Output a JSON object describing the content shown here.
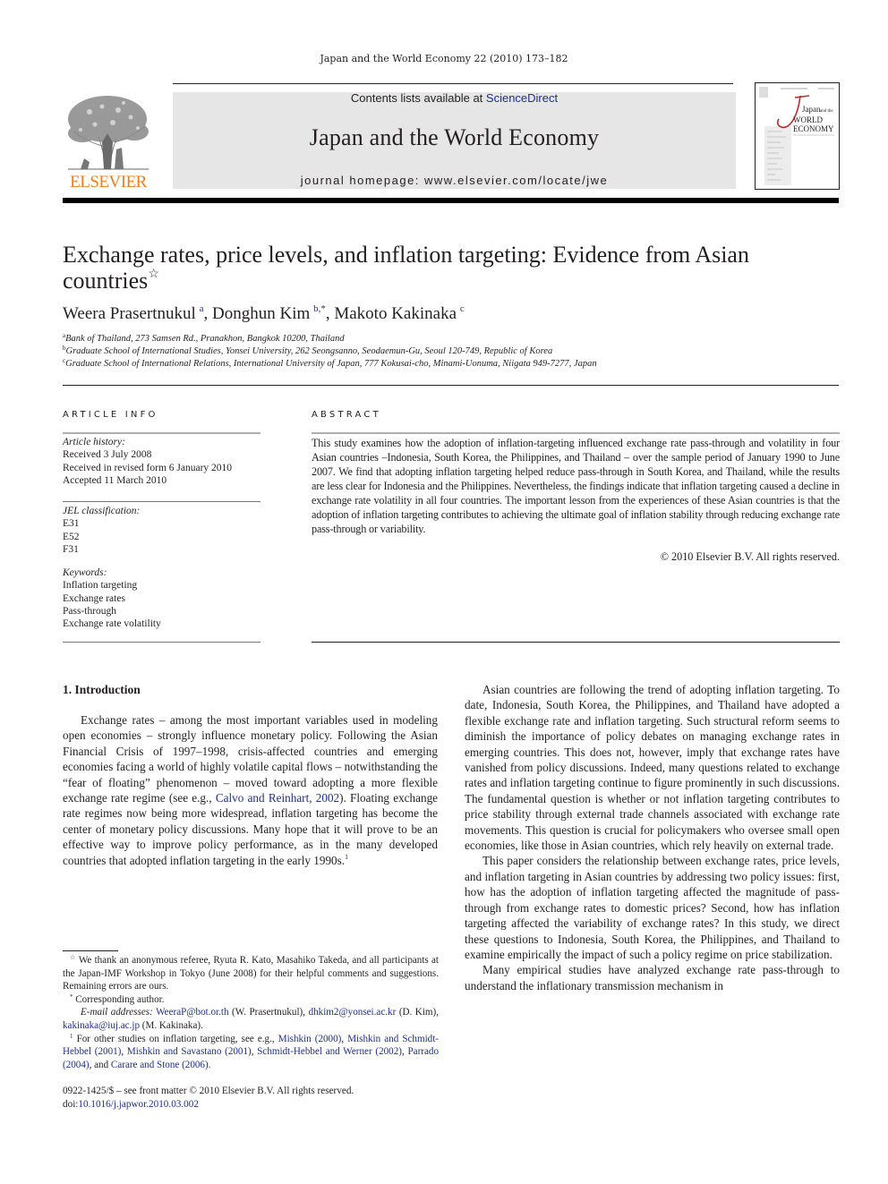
{
  "running_header": "Japan and the World Economy 22 (2010) 173–182",
  "masthead": {
    "publisher_logo_text": "ELSEVIER",
    "contents_prefix": "Contents lists available at ",
    "contents_link": "ScienceDirect",
    "journal_title": "Japan and the World Economy",
    "homepage_label": "journal homepage: ",
    "homepage_url": "www.elsevier.com/locate/jwe",
    "cover": {
      "title_line1_big": "Japan",
      "title_line1_small": "and the",
      "title_line2": "WORLD",
      "title_line3": "ECONOMY"
    },
    "colors": {
      "elsevier_orange": "#f07d1a",
      "link_blue": "#1f2f8a",
      "banner_grey": "#e6e6e6",
      "cover_red": "#c0272d"
    }
  },
  "article": {
    "title": "Exchange rates, price levels, and inflation targeting: Evidence from Asian countries",
    "title_note_mark": "☆",
    "authors": [
      {
        "name": "Weera Prasertnukul",
        "mark": "a"
      },
      {
        "name": "Donghun Kim",
        "mark": "b,*"
      },
      {
        "name": "Makoto Kakinaka",
        "mark": "c"
      }
    ],
    "affiliations": [
      {
        "mark": "a",
        "text": "Bank of Thailand, 273 Samsen Rd., Pranakhon, Bangkok 10200, Thailand"
      },
      {
        "mark": "b",
        "text": "Graduate School of International Studies, Yonsei University, 262 Seongsanno, Seodaemun-Gu, Seoul 120-749, Republic of Korea"
      },
      {
        "mark": "c",
        "text": "Graduate School of International Relations, International University of Japan, 777 Kokusai-cho, Minami-Uonuma, Niigata 949-7277, Japan"
      }
    ]
  },
  "article_info": {
    "heading": "ARTICLE INFO",
    "history_label": "Article history:",
    "history": [
      "Received 3 July 2008",
      "Received in revised form 6 January 2010",
      "Accepted 11 March 2010"
    ],
    "jel_label": "JEL classification:",
    "jel": [
      "E31",
      "E52",
      "F31"
    ],
    "keywords_label": "Keywords:",
    "keywords": [
      "Inflation targeting",
      "Exchange rates",
      "Pass-through",
      "Exchange rate volatility"
    ]
  },
  "abstract": {
    "heading": "ABSTRACT",
    "text": "This study examines how the adoption of inflation-targeting influenced exchange rate pass-through and volatility in four Asian countries –Indonesia, South Korea, the Philippines, and Thailand – over the sample period of January 1990 to June 2007. We find that adopting inflation targeting helped reduce pass-through in South Korea, and Thailand, while the results are less clear for Indonesia and the Philippines. Nevertheless, the findings indicate that inflation targeting caused a decline in exchange rate volatility in all four countries. The important lesson from the experiences of these Asian countries is that the adoption of inflation targeting contributes to achieving the ultimate goal of inflation stability through reducing exchange rate pass-through or variability.",
    "copyright": "© 2010 Elsevier B.V. All rights reserved."
  },
  "body": {
    "section_heading": "1.  Introduction",
    "left_para1_a": "Exchange rates – among the most important variables used in modeling open economies – strongly influence monetary policy. Following the Asian Financial Crisis of 1997–1998, crisis-affected countries and emerging economies facing a world of highly volatile capital flows – notwithstanding the “fear of floating” phenomenon – moved toward adopting a more flexible exchange rate regime (see e.g., ",
    "left_para1_link": "Calvo and Reinhart, 2002",
    "left_para1_b": "). Floating exchange rate regimes now being more widespread, inflation targeting has become the center of monetary policy discussions. Many hope that it will prove to be an effective way to improve policy performance, as in the many developed countries that adopted inflation targeting in the early 1990s.",
    "left_para1_note": "1",
    "right_para1": "Asian countries are following the trend of adopting inflation targeting. To date, Indonesia, South Korea, the Philippines, and Thailand have adopted a flexible exchange rate and inflation targeting. Such structural reform seems to diminish the impor­tance of policy debates on managing exchange rates in emerging countries. This does not, however, imply that exchange rates have vanished from policy discussions. Indeed, many questions related to exchange rates and inflation targeting continue to figure prominently in such discussions. The fundamental question is whether or not inflation targeting contributes to price stability through external trade channels associated with exchange rate movements. This question is crucial for policymakers who oversee small open economies, like those in Asian countries, which rely heavily on external trade.",
    "right_para2": "This paper considers the relationship between exchange rates, price levels, and inflation targeting in Asian countries by addressing two policy issues: first, how has the adoption of inflation targeting affected the magnitude of pass-through from exchange rates to domestic prices? Second, how has inflation targeting affected the variability of exchange rates? In this study, we direct these questions to Indonesia, South Korea, the Philippines, and Thailand to examine empirically the impact of such a policy regime on price stabilization.",
    "right_para3": "Many empirical studies have analyzed exchange rate pass-through to understand the inflationary transmission mechanism in"
  },
  "footnotes": {
    "star_mark": "☆",
    "star_text": "We thank an anonymous referee, Ryuta R. Kato, Masahiko Takeda, and all participants at the Japan-IMF Workshop in Tokyo (June 2008) for their helpful comments and suggestions. Remaining errors are ours.",
    "corr_mark": "*",
    "corr_text": "Corresponding author.",
    "email_label": "E-mail addresses:",
    "emails": [
      {
        "address": "WeeraP@bot.or.th",
        "who": "(W. Prasertnukul),"
      },
      {
        "address": "dhkim2@yonsei.ac.kr",
        "who": "(D. Kim),"
      },
      {
        "address": "kakinaka@iuj.ac.jp",
        "who": "(M. Kakinaka)."
      }
    ],
    "note1_mark": "1",
    "note1_prefix": "For other studies on inflation targeting, see e.g., ",
    "note1_refs": [
      "Mishkin (2000)",
      "Mishkin and Schmidt-Hebbel (2001)",
      "Mishkin and Savastano (2001)",
      "Schmidt-Hebbel and Werner (2002)",
      "Parrado (2004)",
      "Carare and Stone (2006)"
    ],
    "issn_line": "0922-1425/$ – see front matter © 2010 Elsevier B.V. All rights reserved.",
    "doi_label": "doi:",
    "doi": "10.1016/j.japwor.2010.03.002"
  }
}
